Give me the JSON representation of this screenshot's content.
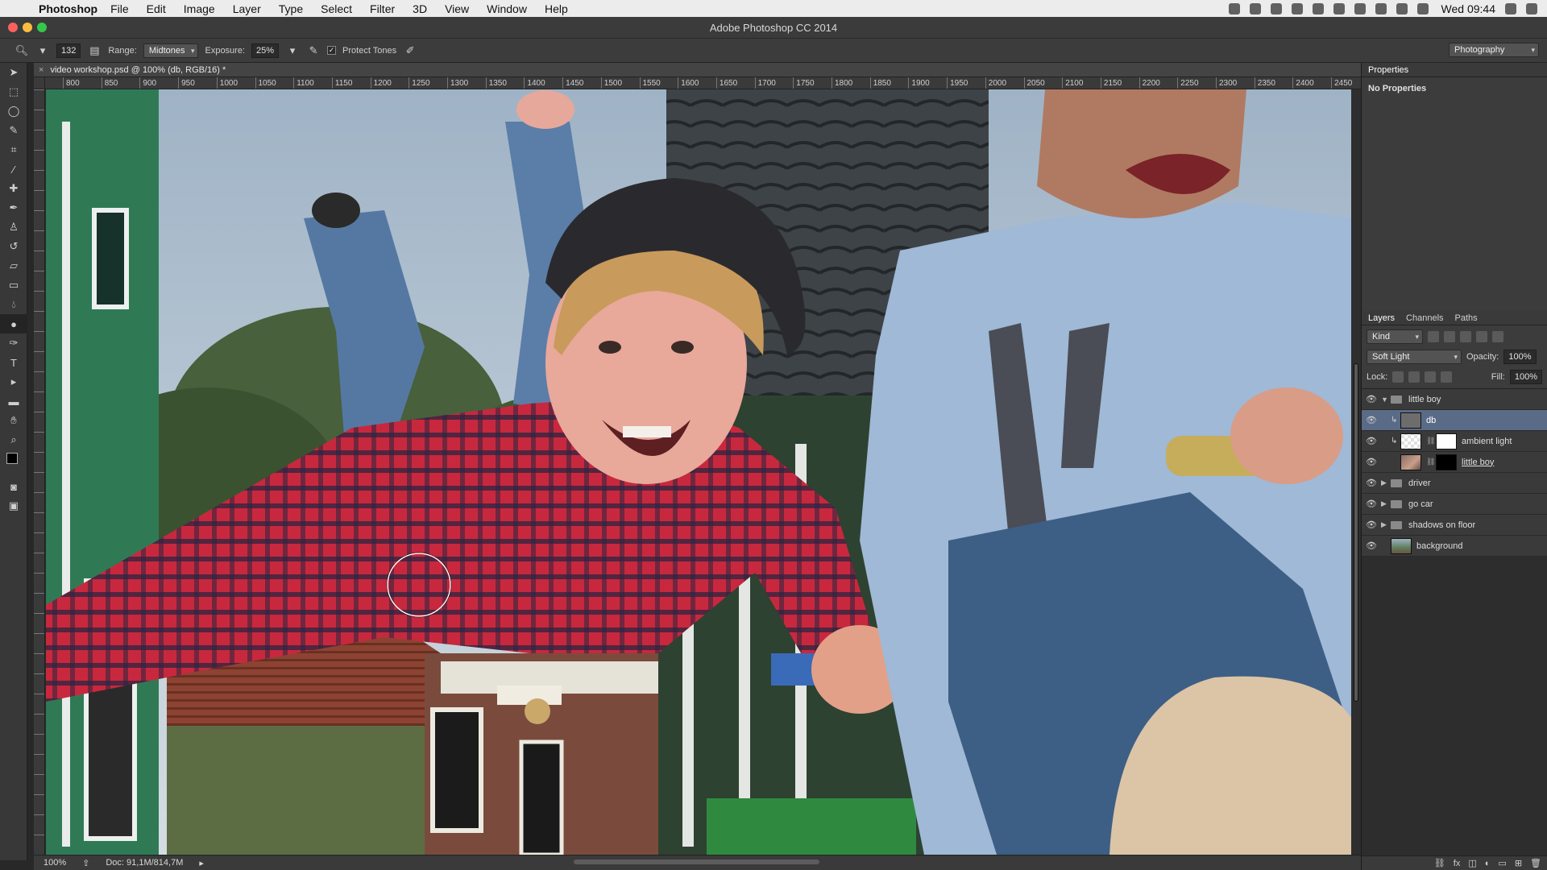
{
  "menubar": {
    "app_name": "Photoshop",
    "menus": [
      "File",
      "Edit",
      "Image",
      "Layer",
      "Type",
      "Select",
      "Filter",
      "3D",
      "View",
      "Window",
      "Help"
    ],
    "clock": "Wed 09:44"
  },
  "window": {
    "title": "Adobe Photoshop CC 2014"
  },
  "options": {
    "brush_size": "132",
    "range_label": "Range:",
    "range_value": "Midtones",
    "exposure_label": "Exposure:",
    "exposure_value": "25%",
    "protect_tones_label": "Protect Tones",
    "protect_tones_checked": "✓",
    "workspace": "Photography"
  },
  "document": {
    "tab_title": "video workshop.psd @ 100% (db, RGB/16) *",
    "ruler_labels": [
      "800",
      "850",
      "900",
      "950",
      "1000",
      "1050",
      "1100",
      "1150",
      "1200",
      "1250",
      "1300",
      "1350",
      "1400",
      "1450",
      "1500",
      "1550",
      "1600",
      "1650",
      "1700",
      "1750",
      "1800",
      "1850",
      "1900",
      "1950",
      "2000",
      "2050",
      "2100",
      "2150",
      "2200",
      "2250",
      "2300",
      "2350",
      "2400",
      "2450"
    ],
    "zoom": "100%",
    "doc_size": "Doc: 91,1M/814,7M"
  },
  "properties": {
    "tab_label": "Properties",
    "body_text": "No Properties"
  },
  "layers_panel": {
    "tabs": [
      "Layers",
      "Channels",
      "Paths"
    ],
    "filter_kind": "Kind",
    "blend_mode": "Soft Light",
    "opacity_label": "Opacity:",
    "opacity_value": "100%",
    "lock_label": "Lock:",
    "fill_label": "Fill:",
    "fill_value": "100%",
    "layers": [
      {
        "name": "little boy",
        "kind": "group",
        "expanded": true
      },
      {
        "name": "db",
        "kind": "layer",
        "selected": true
      },
      {
        "name": "ambient light",
        "kind": "adjustment"
      },
      {
        "name": "little boy",
        "kind": "masked-layer"
      },
      {
        "name": "driver",
        "kind": "group"
      },
      {
        "name": "go car",
        "kind": "group"
      },
      {
        "name": "shadows on floor",
        "kind": "group"
      },
      {
        "name": "background",
        "kind": "layer"
      }
    ]
  },
  "colors": {
    "selection": "#5a6b87",
    "panel": "#3a3a3a",
    "menubar": "#ececec"
  }
}
